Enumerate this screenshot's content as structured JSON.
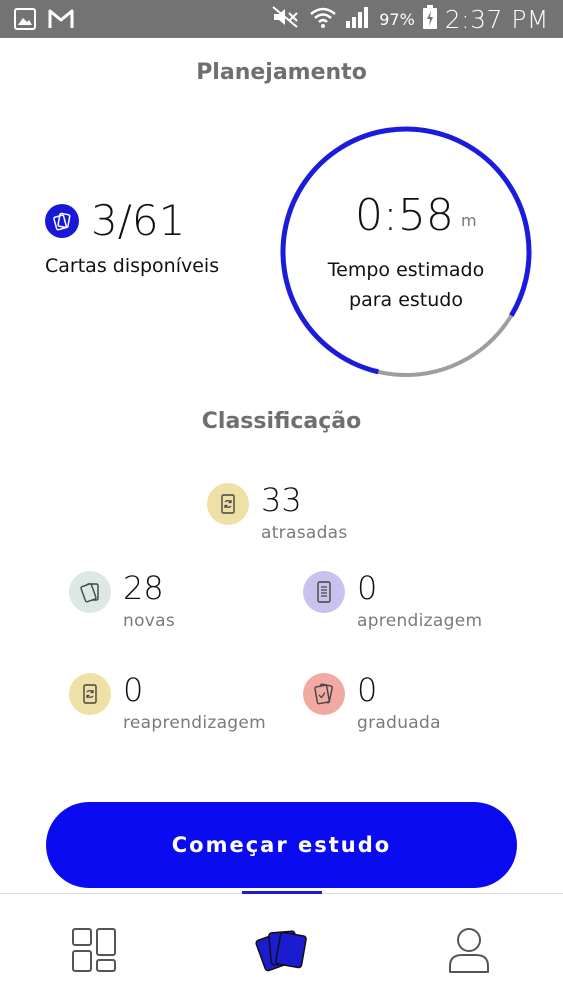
{
  "status_bar": {
    "battery": "97%",
    "clock": "2:37 PM",
    "icons": [
      "image-icon",
      "gmail-icon",
      "mute-icon",
      "wifi-icon",
      "signal-icon",
      "battery-charging-icon"
    ]
  },
  "planning": {
    "title": "Planejamento",
    "cards_value": "3/61",
    "cards_label": "Cartas disponíveis",
    "timer_value": "0:58",
    "timer_unit": "m",
    "timer_label_line1": "Tempo estimado",
    "timer_label_line2": "para estudo",
    "ring_progress": 0.8,
    "ring_color": "#1b1bdc",
    "ring_track_color": "#9e9e9e"
  },
  "classification": {
    "title": "Classificação",
    "items": [
      {
        "value": "33",
        "label": "atrasadas",
        "icon": "refresh-card-icon",
        "color": "#efe0a5"
      },
      {
        "value": "28",
        "label": "novas",
        "icon": "new-cards-icon",
        "color": "#dce8e4"
      },
      {
        "value": "0",
        "label": "aprendizagem",
        "icon": "learning-card-icon",
        "color": "#c8c2ef"
      },
      {
        "value": "0",
        "label": "reaprendizagem",
        "icon": "relearn-card-icon",
        "color": "#efe0a5"
      },
      {
        "value": "0",
        "label": "graduada",
        "icon": "graduated-card-icon",
        "color": "#f1a9a2"
      }
    ]
  },
  "start_button": {
    "label": "Começar estudo",
    "color": "#0b0bf2"
  },
  "bottom_nav": {
    "items": [
      {
        "icon": "dashboard-icon"
      },
      {
        "icon": "study-cards-icon",
        "active": true
      },
      {
        "icon": "profile-icon"
      }
    ],
    "accent": "#1b1bd0"
  }
}
